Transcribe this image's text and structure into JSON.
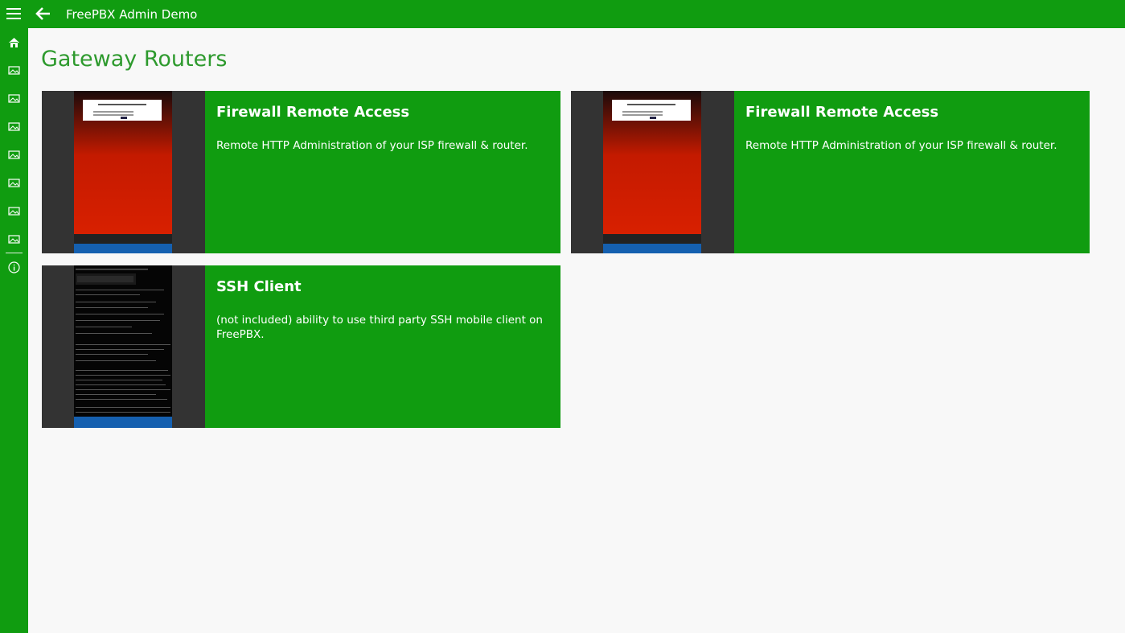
{
  "app": {
    "title": "FreePBX Admin Demo",
    "accent": "#109c10",
    "title_color": "#2e9a2e"
  },
  "page": {
    "title": "Gateway Routers"
  },
  "sidebar": {
    "items": [
      {
        "icon": "home-icon"
      },
      {
        "icon": "image-icon"
      },
      {
        "icon": "image-icon"
      },
      {
        "icon": "image-icon"
      },
      {
        "icon": "image-icon"
      },
      {
        "icon": "image-icon"
      },
      {
        "icon": "image-icon"
      },
      {
        "icon": "image-icon"
      },
      {
        "icon": "info-icon"
      }
    ]
  },
  "tiles": [
    {
      "title": "Firewall Remote Access",
      "description": "Remote HTTP Administration of your ISP firewall & router."
    },
    {
      "title": "Firewall Remote Access",
      "description": "Remote HTTP Administration of your ISP firewall & router."
    },
    {
      "title": "SSH Client",
      "description": "(not included) ability to use third party SSH mobile client on FreePBX."
    }
  ]
}
